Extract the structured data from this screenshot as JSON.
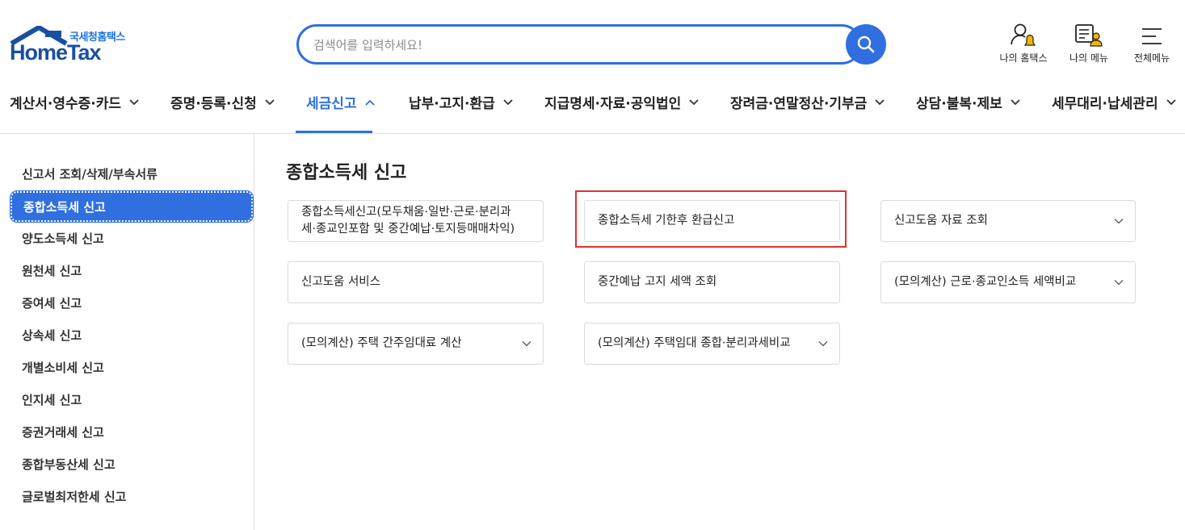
{
  "logo": {
    "sub": "국세청홈택스",
    "main": "HomeTax"
  },
  "search": {
    "placeholder": "검색어를 입력하세요!"
  },
  "utils": [
    {
      "label": "나의 홈택스",
      "icon": "user-bell-icon"
    },
    {
      "label": "나의 메뉴",
      "icon": "my-menu-icon"
    },
    {
      "label": "전체메뉴",
      "icon": "hamburger-icon"
    }
  ],
  "gnb": [
    {
      "label": "계산서·영수증·카드",
      "active": false
    },
    {
      "label": "증명·등록·신청",
      "active": false
    },
    {
      "label": "세금신고",
      "active": true
    },
    {
      "label": "납부·고지·환급",
      "active": false
    },
    {
      "label": "지급명세·자료·공익법인",
      "active": false
    },
    {
      "label": "장려금·연말정산·기부금",
      "active": false
    },
    {
      "label": "상담·불복·제보",
      "active": false
    },
    {
      "label": "세무대리·납세관리",
      "active": false
    }
  ],
  "sidebar": {
    "items": [
      {
        "label": "신고서 조회/삭제/부속서류"
      },
      {
        "label": "종합소득세 신고",
        "active": true
      },
      {
        "label": "양도소득세 신고"
      },
      {
        "label": "원천세 신고"
      },
      {
        "label": "증여세 신고"
      },
      {
        "label": "상속세 신고"
      },
      {
        "label": "개별소비세 신고"
      },
      {
        "label": "인지세 신고"
      },
      {
        "label": "증권거래세 신고"
      },
      {
        "label": "종합부동산세 신고"
      },
      {
        "label": "글로벌최저한세 신고"
      }
    ]
  },
  "main": {
    "title": "종합소득세 신고",
    "cards": [
      {
        "line1": "종합소득세신고(모두채움·일반·근로·분리과",
        "line2": "세·종교인포함 및 중간예납·토지등매매차익)",
        "dropdown": false
      },
      {
        "line1": "종합소득세 기한후 환급신고",
        "line2": "",
        "dropdown": false,
        "highlighted": true
      },
      {
        "line1": "신고도움 자료 조회",
        "line2": "",
        "dropdown": true
      },
      {
        "line1": "신고도움 서비스",
        "line2": "",
        "dropdown": false
      },
      {
        "line1": "중간예납 고지 세액 조회",
        "line2": "",
        "dropdown": false
      },
      {
        "line1": "(모의계산) 근로·종교인소득 세액비교",
        "line2": "",
        "dropdown": true
      },
      {
        "line1": "(모의계산) 주택 간주임대료 계산",
        "line2": "",
        "dropdown": true
      },
      {
        "line1": "(모의계산) 주택임대 종합·분리과세비교",
        "line2": "",
        "dropdown": true
      }
    ]
  },
  "colors": {
    "accent": "#2f6fe0",
    "highlight": "#e03131"
  }
}
